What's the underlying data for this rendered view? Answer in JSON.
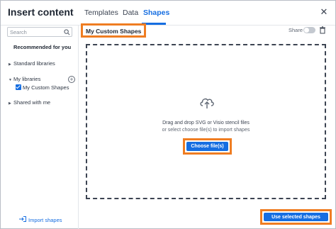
{
  "dialog": {
    "title": "Insert content",
    "close_icon": "close-icon"
  },
  "tabs": [
    {
      "label": "Templates"
    },
    {
      "label": "Data"
    },
    {
      "label": "Shapes",
      "active": true
    }
  ],
  "sidebar": {
    "search_placeholder": "Search",
    "recommended": "Recommended for you",
    "standard_libraries": "Standard libraries",
    "my_libraries": "My libraries",
    "custom_shapes": "My Custom Shapes",
    "shared_with_me": "Shared with me",
    "import_shapes": "Import shapes"
  },
  "main": {
    "library_title": "My Custom Shapes",
    "share_label": "Share",
    "drop_line1": "Drag and drop SVG or Visio stencil files",
    "drop_line2": "or select choose file(s) to import shapes",
    "choose_button": "Choose file(s)",
    "use_button": "Use selected shapes"
  },
  "colors": {
    "accent": "#166ee1",
    "highlight": "#ef7d22"
  }
}
